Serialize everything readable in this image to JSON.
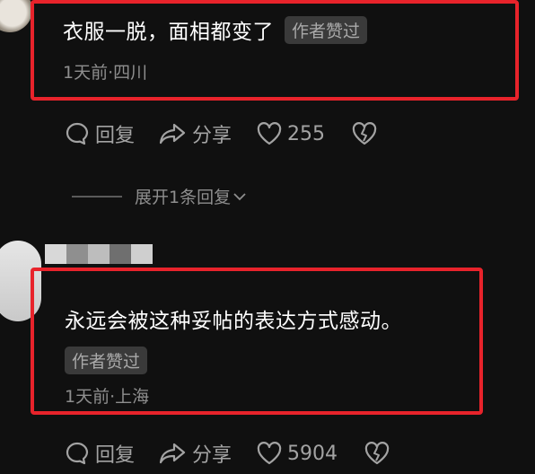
{
  "comments": [
    {
      "text": "衣服一脱，面相都变了",
      "badge": "作者赞过",
      "meta": "1天前·四川",
      "actions": {
        "reply_label": "回复",
        "share_label": "分享",
        "likes": "255"
      }
    },
    {
      "text": "永远会被这种妥帖的表达方式感动。",
      "badge": "作者赞过",
      "meta": "1天前·上海",
      "actions": {
        "reply_label": "回复",
        "share_label": "分享",
        "likes": "5904"
      }
    }
  ],
  "expand_replies": {
    "label": "展开1条回复"
  },
  "colors": {
    "highlight_border": "#e8232b",
    "background": "#101010",
    "badge_bg": "#3a3a3a"
  },
  "icons": [
    "reply-bubble-icon",
    "share-arrow-icon",
    "heart-icon",
    "broken-heart-icon",
    "chevron-down-icon"
  ]
}
